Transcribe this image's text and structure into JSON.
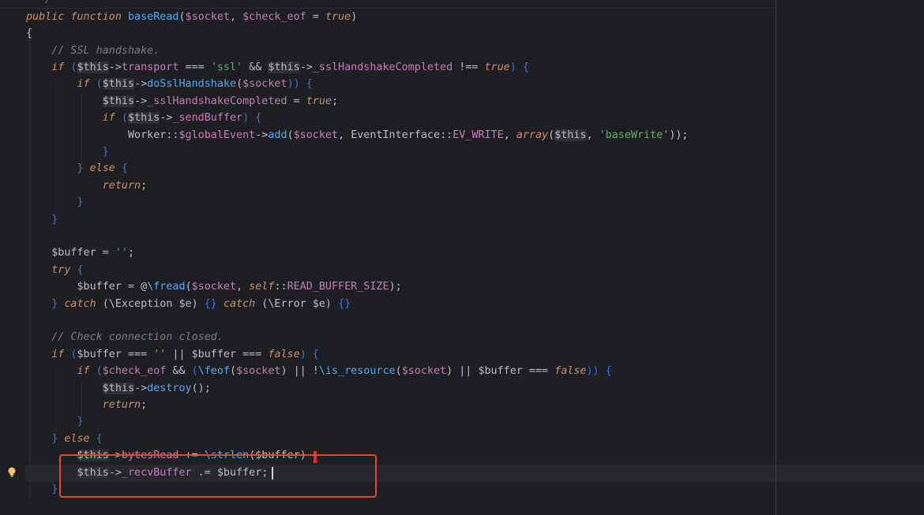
{
  "editor": {
    "language": "PHP",
    "current_line_index": 27,
    "highlighted_lines": [
      26,
      27
    ],
    "lines": [
      [
        {
          "t": "  */",
          "c": "cm"
        }
      ],
      [
        {
          "t": "public",
          "c": "kw"
        },
        {
          "t": " ",
          "c": "dv"
        },
        {
          "t": "function",
          "c": "kw"
        },
        {
          "t": " ",
          "c": "dv"
        },
        {
          "t": "baseRead",
          "c": "fn"
        },
        {
          "t": "(",
          "c": "op"
        },
        {
          "t": "$socket",
          "c": "var"
        },
        {
          "t": ", ",
          "c": "op"
        },
        {
          "t": "$check_eof",
          "c": "var"
        },
        {
          "t": " = ",
          "c": "op"
        },
        {
          "t": "true",
          "c": "kw"
        },
        {
          "t": ")",
          "c": "op"
        }
      ],
      [
        {
          "t": "{",
          "c": "op"
        }
      ],
      [
        {
          "t": "    ",
          "c": "dv"
        },
        {
          "t": "// SSL handshake.",
          "c": "cm"
        }
      ],
      [
        {
          "t": "    ",
          "c": "dv"
        },
        {
          "t": "if",
          "c": "kw"
        },
        {
          "t": " (",
          "c": "br"
        },
        {
          "t": "$this",
          "c": "dv"
        },
        {
          "t": "->",
          "c": "op"
        },
        {
          "t": "transport",
          "c": "var"
        },
        {
          "t": " === ",
          "c": "op"
        },
        {
          "t": "'ssl'",
          "c": "str"
        },
        {
          "t": " && ",
          "c": "op"
        },
        {
          "t": "$this",
          "c": "dv"
        },
        {
          "t": "->",
          "c": "op"
        },
        {
          "t": "_sslHandshakeCompleted",
          "c": "var"
        },
        {
          "t": " !== ",
          "c": "op"
        },
        {
          "t": "true",
          "c": "kw"
        },
        {
          "t": ") {",
          "c": "br"
        }
      ],
      [
        {
          "t": "        ",
          "c": "dv"
        },
        {
          "t": "if",
          "c": "kw"
        },
        {
          "t": " (",
          "c": "br"
        },
        {
          "t": "$this",
          "c": "dv"
        },
        {
          "t": "->",
          "c": "op"
        },
        {
          "t": "doSslHandshake",
          "c": "fn"
        },
        {
          "t": "(",
          "c": "op"
        },
        {
          "t": "$socket",
          "c": "var"
        },
        {
          "t": ")) {",
          "c": "br"
        }
      ],
      [
        {
          "t": "            ",
          "c": "dv"
        },
        {
          "t": "$this",
          "c": "dv"
        },
        {
          "t": "->",
          "c": "op"
        },
        {
          "t": "_sslHandshakeCompleted",
          "c": "var"
        },
        {
          "t": " = ",
          "c": "op"
        },
        {
          "t": "true",
          "c": "kw"
        },
        {
          "t": ";",
          "c": "op"
        }
      ],
      [
        {
          "t": "            ",
          "c": "dv"
        },
        {
          "t": "if",
          "c": "kw"
        },
        {
          "t": " (",
          "c": "br"
        },
        {
          "t": "$this",
          "c": "dv"
        },
        {
          "t": "->",
          "c": "op"
        },
        {
          "t": "_sendBuffer",
          "c": "var"
        },
        {
          "t": ") {",
          "c": "br"
        }
      ],
      [
        {
          "t": "                ",
          "c": "dv"
        },
        {
          "t": "Worker",
          "c": "cls"
        },
        {
          "t": "::",
          "c": "op"
        },
        {
          "t": "$globalEvent",
          "c": "var"
        },
        {
          "t": "->",
          "c": "op"
        },
        {
          "t": "add",
          "c": "fn"
        },
        {
          "t": "(",
          "c": "op"
        },
        {
          "t": "$socket",
          "c": "var"
        },
        {
          "t": ", ",
          "c": "op"
        },
        {
          "t": "EventInterface",
          "c": "cls"
        },
        {
          "t": "::",
          "c": "op"
        },
        {
          "t": "EV_WRITE",
          "c": "cst"
        },
        {
          "t": ", ",
          "c": "op"
        },
        {
          "t": "array",
          "c": "kw"
        },
        {
          "t": "(",
          "c": "op"
        },
        {
          "t": "$this",
          "c": "dv"
        },
        {
          "t": ", ",
          "c": "op"
        },
        {
          "t": "'baseWrite'",
          "c": "str"
        },
        {
          "t": "));",
          "c": "op"
        }
      ],
      [
        {
          "t": "            ",
          "c": "dv"
        },
        {
          "t": "}",
          "c": "br"
        }
      ],
      [
        {
          "t": "        ",
          "c": "dv"
        },
        {
          "t": "} ",
          "c": "br"
        },
        {
          "t": "else",
          "c": "kw"
        },
        {
          "t": " {",
          "c": "br"
        }
      ],
      [
        {
          "t": "            ",
          "c": "dv"
        },
        {
          "t": "return",
          "c": "kw"
        },
        {
          "t": ";",
          "c": "op"
        }
      ],
      [
        {
          "t": "        ",
          "c": "dv"
        },
        {
          "t": "}",
          "c": "br"
        }
      ],
      [
        {
          "t": "    ",
          "c": "dv"
        },
        {
          "t": "}",
          "c": "br"
        }
      ],
      [
        {
          "t": "",
          "c": "dv"
        }
      ],
      [
        {
          "t": "    ",
          "c": "dv"
        },
        {
          "t": "$buffer",
          "c": "dv"
        },
        {
          "t": " = ",
          "c": "op"
        },
        {
          "t": "''",
          "c": "str"
        },
        {
          "t": ";",
          "c": "op"
        }
      ],
      [
        {
          "t": "    ",
          "c": "dv"
        },
        {
          "t": "try",
          "c": "kw"
        },
        {
          "t": " {",
          "c": "br"
        }
      ],
      [
        {
          "t": "        ",
          "c": "dv"
        },
        {
          "t": "$buffer",
          "c": "dv"
        },
        {
          "t": " = @",
          "c": "op"
        },
        {
          "t": "\\fread",
          "c": "fn"
        },
        {
          "t": "(",
          "c": "op"
        },
        {
          "t": "$socket",
          "c": "var"
        },
        {
          "t": ", ",
          "c": "op"
        },
        {
          "t": "self",
          "c": "selfk"
        },
        {
          "t": "::",
          "c": "op"
        },
        {
          "t": "READ_BUFFER_SIZE",
          "c": "cst2"
        },
        {
          "t": ");",
          "c": "op"
        }
      ],
      [
        {
          "t": "    ",
          "c": "dv"
        },
        {
          "t": "} ",
          "c": "br"
        },
        {
          "t": "catch",
          "c": "kw"
        },
        {
          "t": " (\\Exception $e) ",
          "c": "op"
        },
        {
          "t": "{}",
          "c": "br"
        },
        {
          "t": " ",
          "c": "dv"
        },
        {
          "t": "catch",
          "c": "kw"
        },
        {
          "t": " (\\Error $e) ",
          "c": "op"
        },
        {
          "t": "{}",
          "c": "br"
        }
      ],
      [
        {
          "t": "",
          "c": "dv"
        }
      ],
      [
        {
          "t": "    ",
          "c": "dv"
        },
        {
          "t": "// Check connection closed.",
          "c": "cm"
        }
      ],
      [
        {
          "t": "    ",
          "c": "dv"
        },
        {
          "t": "if",
          "c": "kw"
        },
        {
          "t": " (",
          "c": "br"
        },
        {
          "t": "$buffer",
          "c": "dv"
        },
        {
          "t": " === ",
          "c": "op"
        },
        {
          "t": "''",
          "c": "str"
        },
        {
          "t": " || ",
          "c": "op"
        },
        {
          "t": "$buffer",
          "c": "dv"
        },
        {
          "t": " === ",
          "c": "op"
        },
        {
          "t": "false",
          "c": "kw"
        },
        {
          "t": ") {",
          "c": "br"
        }
      ],
      [
        {
          "t": "        ",
          "c": "dv"
        },
        {
          "t": "if",
          "c": "kw"
        },
        {
          "t": " (",
          "c": "br"
        },
        {
          "t": "$check_eof",
          "c": "var"
        },
        {
          "t": " && ",
          "c": "op"
        },
        {
          "t": "(",
          "c": "br"
        },
        {
          "t": "\\feof",
          "c": "fn"
        },
        {
          "t": "(",
          "c": "op"
        },
        {
          "t": "$socket",
          "c": "var"
        },
        {
          "t": ") || !",
          "c": "op"
        },
        {
          "t": "\\is_resource",
          "c": "fn"
        },
        {
          "t": "(",
          "c": "op"
        },
        {
          "t": "$socket",
          "c": "var"
        },
        {
          "t": ") || ",
          "c": "op"
        },
        {
          "t": "$buffer",
          "c": "dv"
        },
        {
          "t": " === ",
          "c": "op"
        },
        {
          "t": "false",
          "c": "kw"
        },
        {
          "t": ")) {",
          "c": "br"
        }
      ],
      [
        {
          "t": "            ",
          "c": "dv"
        },
        {
          "t": "$this",
          "c": "dv"
        },
        {
          "t": "->",
          "c": "op"
        },
        {
          "t": "destroy",
          "c": "fn"
        },
        {
          "t": "();",
          "c": "op"
        }
      ],
      [
        {
          "t": "            ",
          "c": "dv"
        },
        {
          "t": "return",
          "c": "kw"
        },
        {
          "t": ";",
          "c": "op"
        }
      ],
      [
        {
          "t": "        ",
          "c": "dv"
        },
        {
          "t": "}",
          "c": "br"
        }
      ],
      [
        {
          "t": "    ",
          "c": "dv"
        },
        {
          "t": "} ",
          "c": "br"
        },
        {
          "t": "else",
          "c": "kw"
        },
        {
          "t": " {",
          "c": "br"
        }
      ],
      [
        {
          "t": "        ",
          "c": "dv"
        },
        {
          "t": "$this",
          "c": "dv"
        },
        {
          "t": "->",
          "c": "op"
        },
        {
          "t": "bytesRead",
          "c": "var"
        },
        {
          "t": " += ",
          "c": "op"
        },
        {
          "t": "\\strlen",
          "c": "fn"
        },
        {
          "t": "(",
          "c": "op"
        },
        {
          "t": "$buffer",
          "c": "dv"
        },
        {
          "t": ")",
          "c": "op"
        }
      ],
      [
        {
          "t": "        ",
          "c": "dv"
        },
        {
          "t": "$this",
          "c": "dv"
        },
        {
          "t": "->",
          "c": "op"
        },
        {
          "t": "_recvBuffer",
          "c": "var"
        },
        {
          "t": " .= ",
          "c": "op"
        },
        {
          "t": "$buffer",
          "c": "dv"
        },
        {
          "t": ";",
          "c": "op"
        }
      ],
      [
        {
          "t": "    ",
          "c": "dv"
        },
        {
          "t": "}",
          "c": "br"
        }
      ]
    ]
  },
  "annotations": {
    "highlight_box_color": "#e3472d",
    "gutter_icon": "lightbulb-icon"
  }
}
